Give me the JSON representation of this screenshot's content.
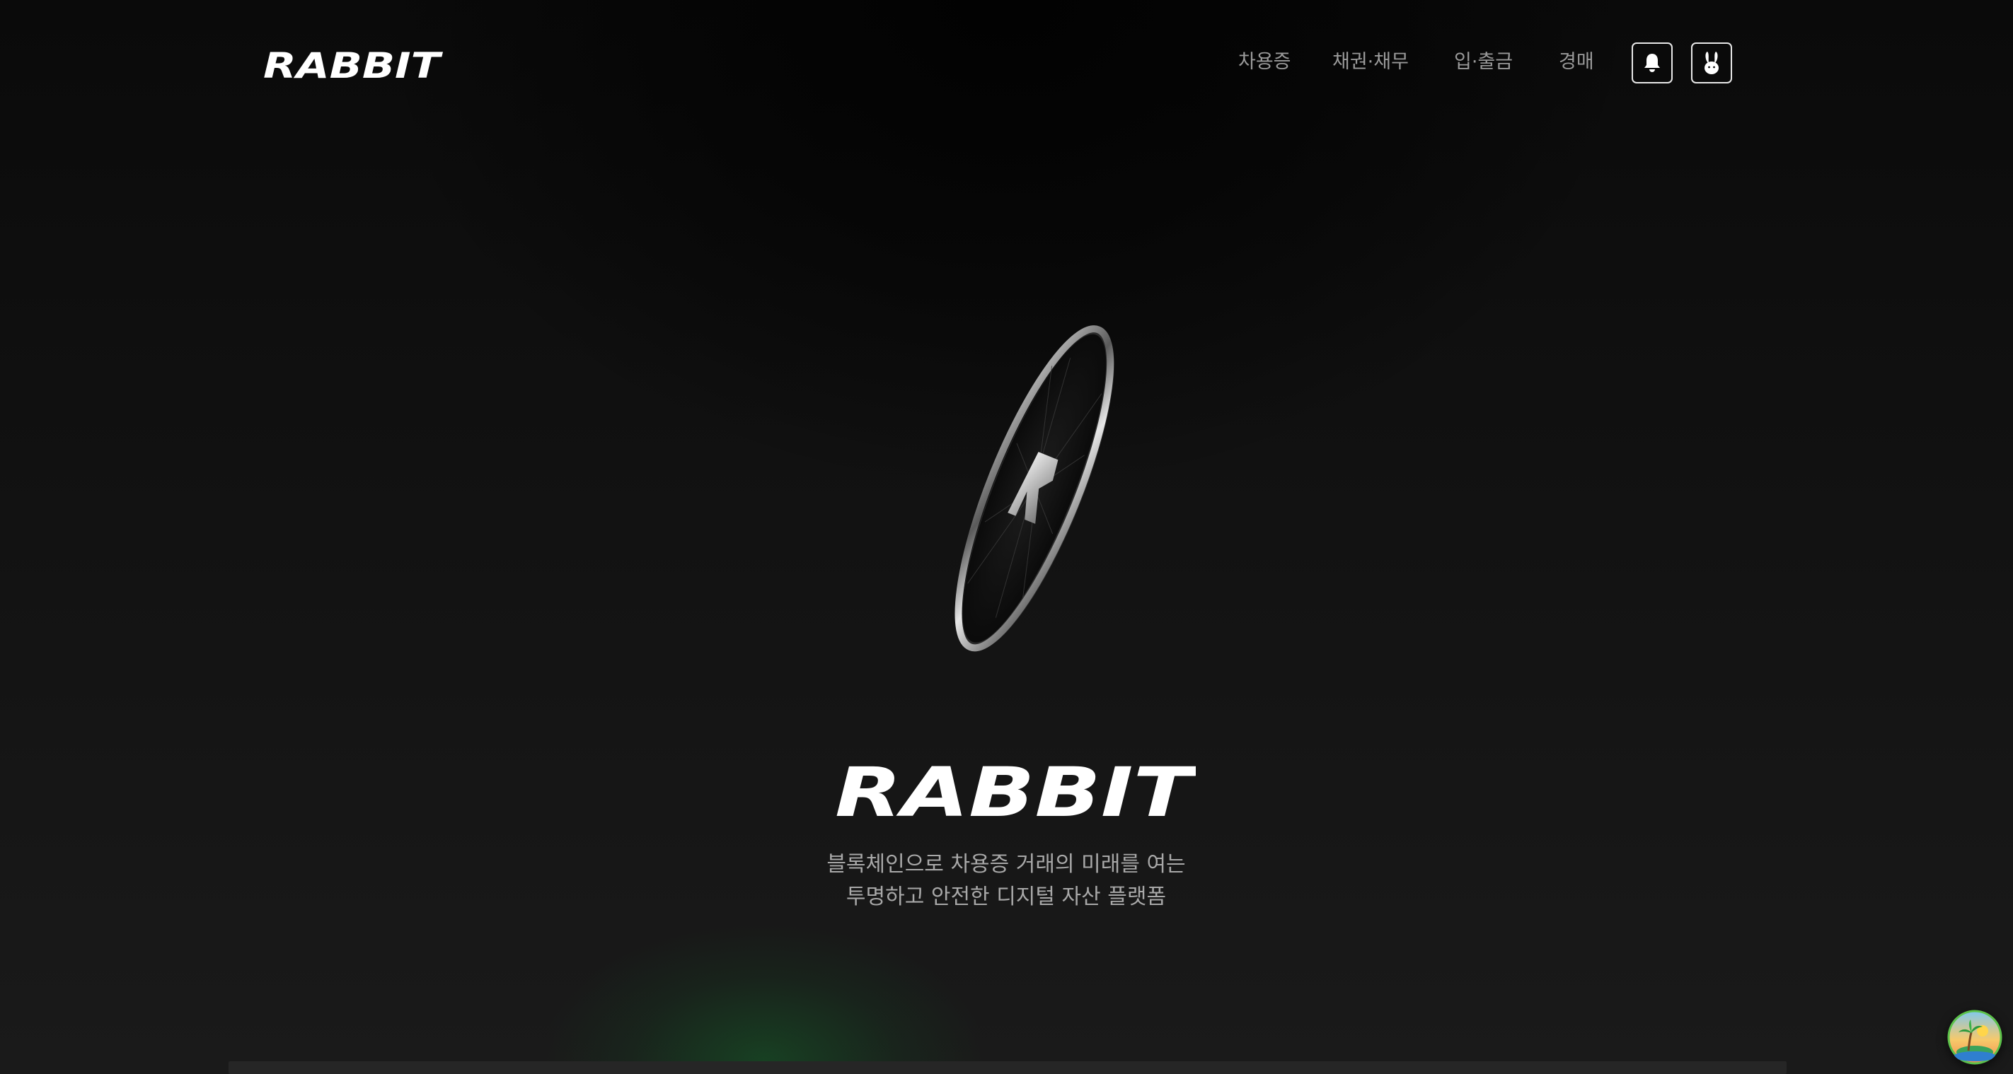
{
  "brand": {
    "logo_text": "RABBIT"
  },
  "nav": {
    "items": [
      {
        "label": "차용증"
      },
      {
        "label": "채권·채무"
      },
      {
        "label": "입·출금"
      },
      {
        "label": "경매"
      }
    ],
    "notification_icon": "bell-icon",
    "profile_icon": "rabbit-icon"
  },
  "hero": {
    "coin_icon": "rabbit-coin",
    "title": "RABBIT",
    "tagline_line1": "블록체인으로 차용증 거래의 미래를 여는",
    "tagline_line2": "투명하고 안전한 디지털 자산 플랫폼"
  },
  "floating": {
    "icon": "palm-island-icon"
  },
  "colors": {
    "background": "#0b0b0b",
    "text_primary": "#ffffff",
    "text_muted": "#9a9a9a",
    "glow_green": "#146e2d"
  }
}
